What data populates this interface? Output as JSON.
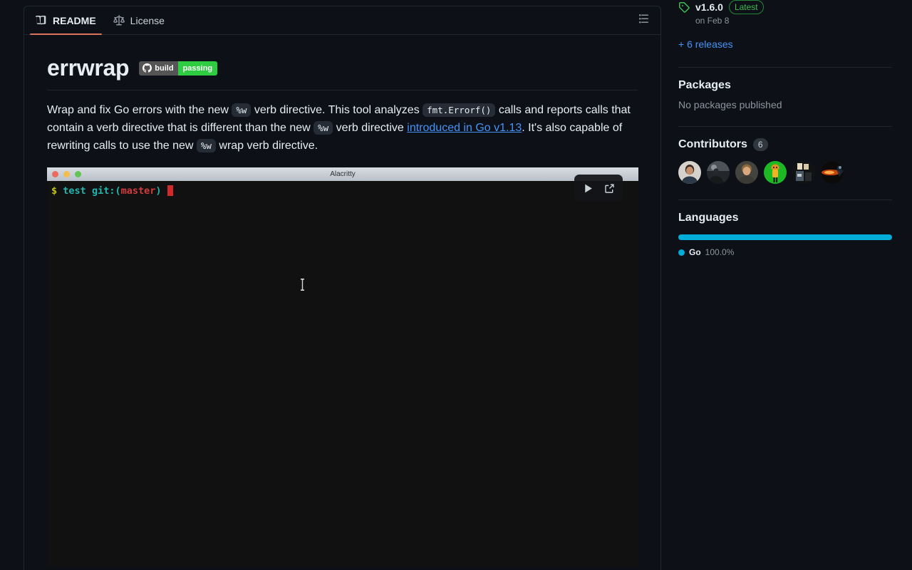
{
  "readme_panel": {
    "tabs": [
      {
        "label": "README",
        "icon": "book-icon",
        "active": true
      },
      {
        "label": "License",
        "icon": "law-scale-icon",
        "active": false
      }
    ],
    "outline_icon": "list-unordered-icon"
  },
  "article": {
    "title": "errwrap",
    "badge": {
      "icon": "github-mark-icon",
      "left_label": "build",
      "right_label": "passing",
      "left_color": "#555555",
      "right_color": "#2ecc40"
    },
    "description": {
      "part1": "Wrap and fix Go errors with the new ",
      "code1": "%w",
      "part2": " verb directive. This tool analyzes ",
      "code2": "fmt.Errorf()",
      "part3": " calls and reports calls that contain a verb directive that is different than the new ",
      "code3": "%w",
      "part4": " verb directive ",
      "link": "introduced in Go v1.13",
      "part5": ". It's also capable of rewriting calls to use the new ",
      "code4": "%w",
      "part6": " wrap verb directive."
    }
  },
  "terminal": {
    "title": "Alacritty",
    "window_buttons": [
      "close-red",
      "minimize-yellow",
      "zoom-green"
    ],
    "prompt": {
      "symbol": "$",
      "dir": "test",
      "git_prefix": "git:",
      "open_paren": "(",
      "branch": "master",
      "close_paren": ")"
    },
    "controls": [
      {
        "name": "play-button",
        "icon": "play-icon"
      },
      {
        "name": "fullscreen-button",
        "icon": "external-link-icon"
      }
    ]
  },
  "sidebar": {
    "release": {
      "tag_icon": "tag-icon",
      "version": "v1.6.0",
      "latest_label": "Latest",
      "date": "on Feb 8",
      "more_link": "+ 6 releases"
    },
    "packages": {
      "heading": "Packages",
      "empty_text": "No packages published"
    },
    "contributors": {
      "heading": "Contributors",
      "count": "6",
      "avatars": [
        {
          "name": "contributor-avatar-1",
          "bg": "#d9d5cf"
        },
        {
          "name": "contributor-avatar-2",
          "bg": "#2b2f33"
        },
        {
          "name": "contributor-avatar-3",
          "bg": "#3a3a38"
        },
        {
          "name": "contributor-avatar-4",
          "bg": "#1db924"
        },
        {
          "name": "contributor-avatar-5",
          "bg": "#17191c"
        },
        {
          "name": "contributor-avatar-6",
          "bg": "#120d0c"
        }
      ]
    },
    "languages": {
      "heading": "Languages",
      "items": [
        {
          "name": "Go",
          "percent": "100.0%",
          "color": "#00ADD8",
          "width": "100%"
        }
      ]
    }
  }
}
